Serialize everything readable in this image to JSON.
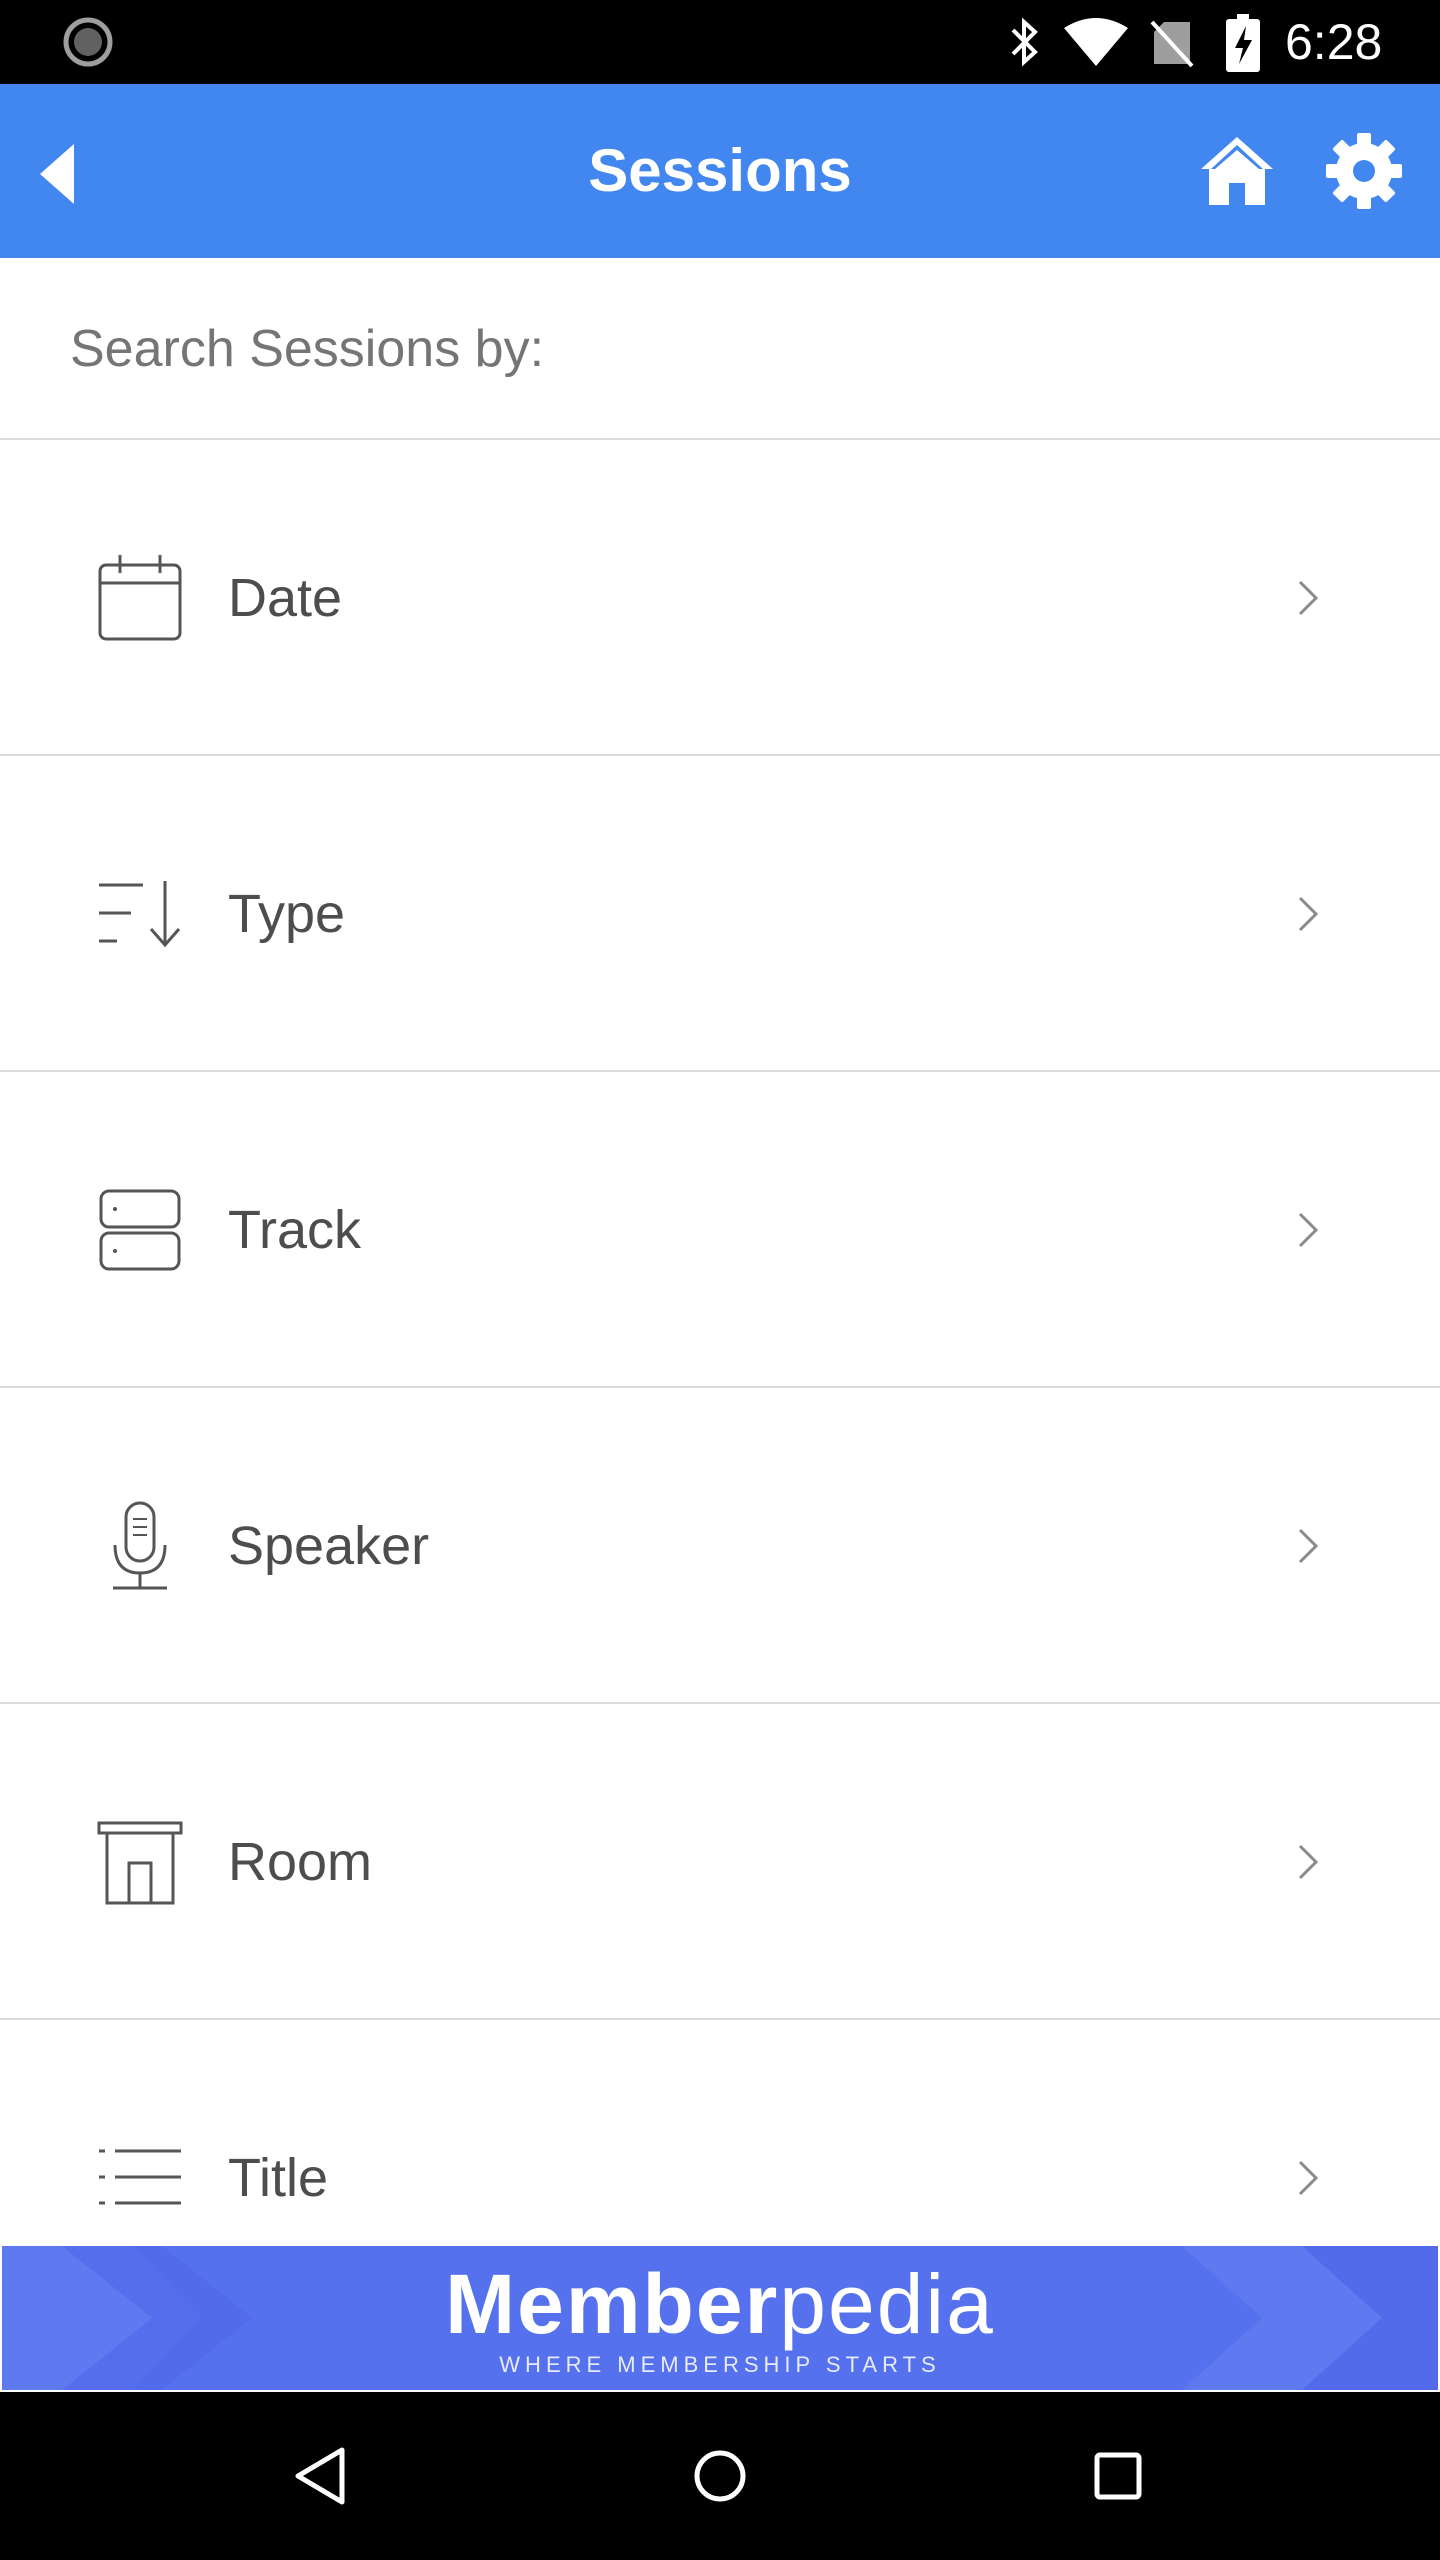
{
  "status_bar": {
    "time": "6:28",
    "icons": [
      "sync-icon",
      "bluetooth-icon",
      "wifi-icon",
      "no-sim-icon",
      "battery-charging-icon"
    ]
  },
  "app_bar": {
    "title": "Sessions",
    "background": "#4287f0",
    "icons": [
      "back-arrow-icon",
      "home-icon",
      "settings-gear-icon"
    ]
  },
  "search": {
    "label": "Search Sessions by:"
  },
  "menu": {
    "items": [
      {
        "label": "Date",
        "icon": "calendar-icon"
      },
      {
        "label": "Type",
        "icon": "sort-icon"
      },
      {
        "label": "Track",
        "icon": "server-stack-icon"
      },
      {
        "label": "Speaker",
        "icon": "microphone-icon"
      },
      {
        "label": "Room",
        "icon": "room-icon"
      },
      {
        "label": "Title",
        "icon": "list-icon"
      }
    ]
  },
  "ad": {
    "brand_bold": "Member",
    "brand_light": "pedia",
    "tagline": "WHERE MEMBERSHIP STARTS",
    "background": "#5671ee"
  },
  "nav_bar": {
    "buttons": [
      "back-triangle-icon",
      "home-circle-icon",
      "recents-square-icon"
    ]
  }
}
